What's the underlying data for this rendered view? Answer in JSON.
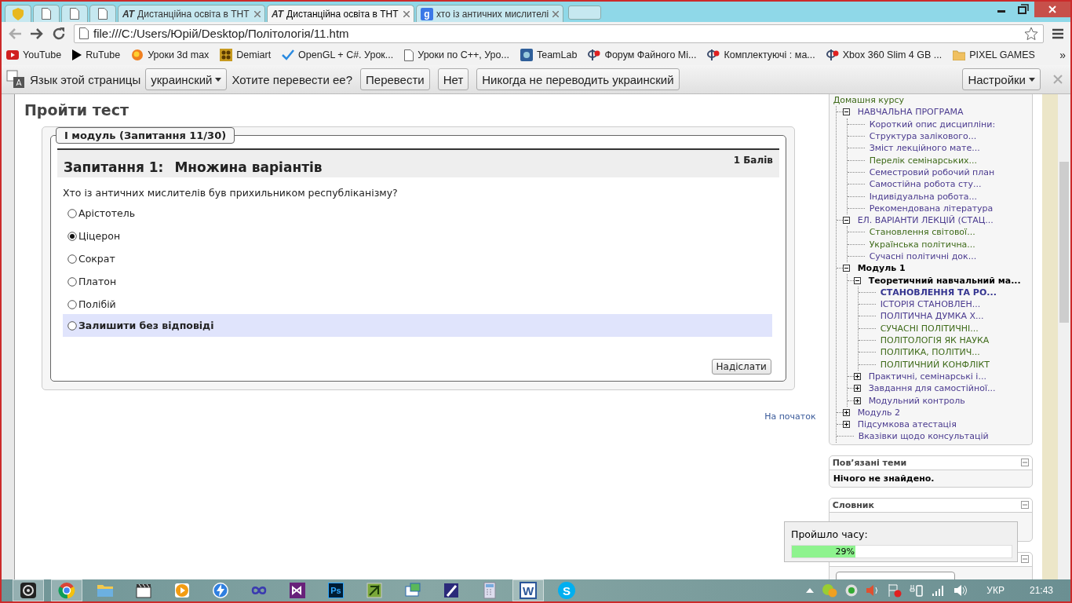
{
  "tabs": [
    {
      "kind": "shield",
      "selected": false
    },
    {
      "kind": "page",
      "selected": false
    },
    {
      "kind": "page",
      "selected": false
    },
    {
      "kind": "page",
      "selected": false
    },
    {
      "kind": "site",
      "glyph": "AT",
      "title": "Дистанційна освіта в ТНТ",
      "selected": false
    },
    {
      "kind": "site",
      "glyph": "AT",
      "title": "Дистанційна освіта в ТНТ",
      "selected": true
    },
    {
      "kind": "search",
      "glyph": "g",
      "title": "хто із античних мислителі",
      "selected": false
    }
  ],
  "address": "file:///C:/Users/Юрій/Desktop/Політологія/11.htm",
  "bookmarks": [
    {
      "kind": "video",
      "label": "YouTube"
    },
    {
      "kind": "triangle",
      "label": "RuTube"
    },
    {
      "kind": "blob",
      "label": "Уроки 3d max"
    },
    {
      "kind": "grid",
      "label": "Demiart"
    },
    {
      "kind": "check",
      "label": "OpenGL + C#. Урок..."
    },
    {
      "kind": "page",
      "label": "Уроки по C++, Уро..."
    },
    {
      "kind": "square",
      "label": "TeamLab"
    },
    {
      "kind": "pin",
      "label": "Форум Файного Мі..."
    },
    {
      "kind": "pin",
      "label": "Комплектуючі : ма..."
    },
    {
      "kind": "pin",
      "label": "Xbox 360 Slim 4 GB ..."
    },
    {
      "kind": "folder",
      "label": "PIXEL GAMES"
    }
  ],
  "bookmarks_more": "»",
  "translate_bar": {
    "label": "Язык этой страницы",
    "language": "украинский",
    "question": "Хотите перевести ее?",
    "buttons": [
      "Перевести",
      "Нет",
      "Никогда не переводить украинский"
    ],
    "options": "Настройки"
  },
  "page": {
    "title": "Пройти тест",
    "legend": "I модуль (Запитання 11/30)",
    "question_number": "Запитання 1:",
    "question_type": "Множина варіантів",
    "points": "1 Балів",
    "question": "Хто із античних мислителів був прихильником республіканізму?",
    "answers": [
      {
        "label": "Арістотель",
        "selected": false,
        "kind": "answer"
      },
      {
        "label": "Ціцерон",
        "selected": true,
        "kind": "answer"
      },
      {
        "label": "Сократ",
        "selected": false,
        "kind": "answer"
      },
      {
        "label": "Платон",
        "selected": false,
        "kind": "answer"
      },
      {
        "label": "Полібій",
        "selected": false,
        "kind": "answer"
      },
      {
        "label": "Залишити без відповіді",
        "selected": false,
        "kind": "skip"
      }
    ],
    "submit": "Надіслати",
    "top_link": "На початок"
  },
  "sidebar": {
    "tree": {
      "label": "Домашня курсу",
      "kind": "link",
      "visited": true,
      "children": [
        {
          "label": "НАВЧАЛЬНА ПРОГРАМА",
          "kind": "link",
          "visited": false,
          "expanded": true,
          "children": [
            {
              "label": "Короткий опис дисципліни:",
              "kind": "link",
              "visited": false
            },
            {
              "label": "Структура залікового...",
              "kind": "link",
              "visited": false
            },
            {
              "label": "Зміст лекційного мате...",
              "kind": "link",
              "visited": false
            },
            {
              "label": "Перелік семінарських...",
              "kind": "link",
              "visited": true
            },
            {
              "label": "Семестровий робочий план",
              "kind": "link",
              "visited": false
            },
            {
              "label": "Самостійна робота сту...",
              "kind": "link",
              "visited": false
            },
            {
              "label": "Індивідуальна робота...",
              "kind": "link",
              "visited": false
            },
            {
              "label": "Рекомендована література",
              "kind": "link",
              "visited": false
            }
          ]
        },
        {
          "label": "ЕЛ. ВАРІАНТИ ЛЕКЦІЙ (СТАЦ...",
          "kind": "link",
          "visited": false,
          "expanded": true,
          "children": [
            {
              "label": "Становлення світової...",
              "kind": "link",
              "visited": true
            },
            {
              "label": "Українська політична...",
              "kind": "link",
              "visited": true
            },
            {
              "label": "Сучасні політичні док...",
              "kind": "link",
              "visited": false
            }
          ]
        },
        {
          "label": "Модуль 1",
          "kind": "heading",
          "visited": false,
          "expanded": true,
          "children": [
            {
              "label": "Теоретичний навчальний ма...",
              "kind": "heading",
              "visited": false,
              "expanded": true,
              "children": [
                {
                  "label": "СТАНОВЛЕННЯ ТА РО...",
                  "kind": "current",
                  "visited": false
                },
                {
                  "label": "ІСТОРІЯ СТАНОВЛЕН...",
                  "kind": "link",
                  "visited": false
                },
                {
                  "label": "ПОЛІТИЧНА ДУМКА Х...",
                  "kind": "link",
                  "visited": false
                },
                {
                  "label": "СУЧАСНІ ПОЛІТИЧНІ...",
                  "kind": "link",
                  "visited": true
                },
                {
                  "label": "ПОЛІТОЛОГІЯ ЯК НАУКА",
                  "kind": "link",
                  "visited": true
                },
                {
                  "label": "ПОЛІТИКА, ПОЛІТИЧ...",
                  "kind": "link",
                  "visited": true
                },
                {
                  "label": "ПОЛІТИЧНИЙ КОНФЛІКТ",
                  "kind": "link",
                  "visited": true
                }
              ]
            },
            {
              "label": "Практичні, семінарські і...",
              "kind": "link",
              "visited": false,
              "expanded": false
            },
            {
              "label": "Завдання для самостійної...",
              "kind": "link",
              "visited": false,
              "expanded": false
            },
            {
              "label": "Модульний контроль",
              "kind": "link",
              "visited": false,
              "expanded": false
            }
          ]
        },
        {
          "label": "Модуль 2",
          "kind": "link",
          "visited": false,
          "expanded": false
        },
        {
          "label": "Підсумкова атестація",
          "kind": "link",
          "visited": false,
          "expanded": false
        },
        {
          "label": "Вказівки щодо консультацій",
          "kind": "link",
          "visited": false
        }
      ]
    },
    "related": {
      "title": "Пов’язані теми",
      "text": "Нічого не знайдено."
    },
    "glossary": {
      "title": "Словник"
    }
  },
  "timer": {
    "label": "Пройшло часу:",
    "level": 0.29,
    "reading": "29%"
  },
  "taskbar": {
    "apps": [
      {
        "kind": "spiral",
        "active": true
      },
      {
        "kind": "globe",
        "active": true
      },
      {
        "kind": "folder",
        "active": false
      },
      {
        "kind": "clapper",
        "active": false
      },
      {
        "kind": "play",
        "active": false
      },
      {
        "kind": "bolt",
        "active": false
      },
      {
        "kind": "infinity",
        "active": false
      },
      {
        "kind": "ribbon",
        "active": false
      },
      {
        "kind": "tile",
        "glyph": "Ps",
        "active": false
      },
      {
        "kind": "leaf",
        "active": false
      },
      {
        "kind": "mail",
        "active": false
      },
      {
        "kind": "pen",
        "active": false
      },
      {
        "kind": "calc",
        "active": false
      },
      {
        "kind": "doc",
        "glyph": "W",
        "active": true
      },
      {
        "kind": "bubble",
        "glyph": "S",
        "active": false
      }
    ],
    "language": "УКР",
    "time": "21:43"
  }
}
